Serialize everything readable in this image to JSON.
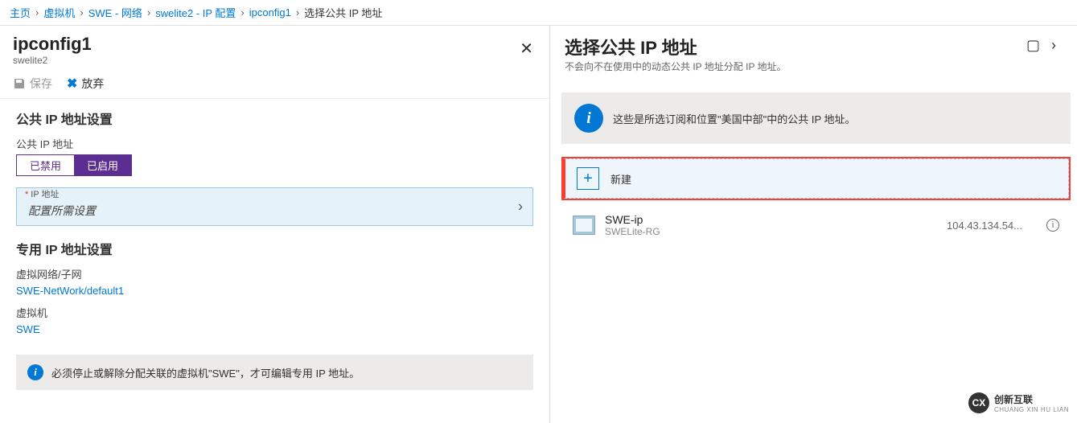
{
  "breadcrumb": {
    "home": "主页",
    "vm": "虚拟机",
    "nic": "SWE - 网络",
    "ipcfg": "swelite2 - IP 配置",
    "ipcfgname": "ipconfig1",
    "current": "选择公共 IP 地址"
  },
  "left": {
    "title": "ipconfig1",
    "subtitle": "swelite2",
    "toolbar": {
      "save": "保存",
      "discard": "放弃"
    },
    "public_section_title": "公共 IP 地址设置",
    "public_label": "公共 IP 地址",
    "toggle_disabled": "已禁用",
    "toggle_enabled": "已启用",
    "ip_address_label": "IP 地址",
    "ip_placeholder": "配置所需设置",
    "private_section_title": "专用 IP 地址设置",
    "vnet_label": "虚拟网络/子网",
    "vnet_value": "SWE-NetWork/default1",
    "vm_label": "虚拟机",
    "vm_value": "SWE",
    "bottom_notice": "必须停止或解除分配关联的虚拟机\"SWE\"，才可编辑专用 IP 地址。"
  },
  "right": {
    "title": "选择公共 IP 地址",
    "subtitle": "不会向不在使用中的动态公共 IP 地址分配 IP 地址。",
    "info_text": "这些是所选订阅和位置\"美国中部\"中的公共 IP 地址。",
    "new_label": "新建",
    "ip": {
      "name": "SWE-ip",
      "rg": "SWELite-RG",
      "addr": "104.43.134.54..."
    }
  },
  "logo": {
    "text": "创新互联",
    "sub": "CHUANG XIN HU LIAN"
  }
}
